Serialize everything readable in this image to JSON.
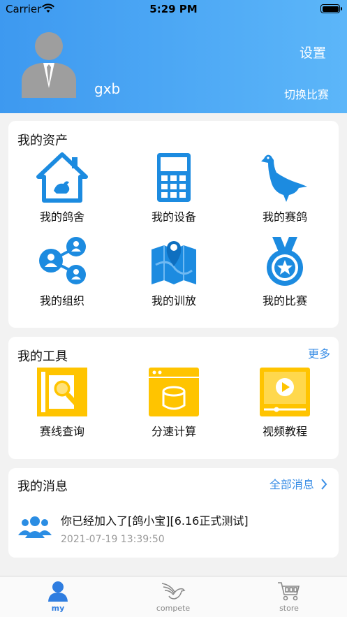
{
  "status_bar": {
    "carrier": "Carrier",
    "time": "5:29 PM"
  },
  "header": {
    "username": "gxb",
    "settings_label": "设置",
    "switch_label": "切换比赛"
  },
  "colors": {
    "header_start": "#3d99f0",
    "header_end": "#5cb6f9",
    "icon_blue": "#1c8be0",
    "icon_yellow": "#ffc400",
    "link_blue": "#3a8ee6",
    "tab_active": "#2f7de0"
  },
  "assets": {
    "title": "我的资产",
    "items": [
      {
        "label": "我的鸽舍",
        "icon": "house-pigeon-icon"
      },
      {
        "label": "我的设备",
        "icon": "device-icon"
      },
      {
        "label": "我的赛鸽",
        "icon": "pigeon-icon"
      },
      {
        "label": "我的组织",
        "icon": "organization-icon"
      },
      {
        "label": "我的训放",
        "icon": "map-pin-icon"
      },
      {
        "label": "我的比赛",
        "icon": "medal-icon"
      }
    ]
  },
  "tools": {
    "title": "我的工具",
    "more_label": "更多",
    "items": [
      {
        "label": "赛线查询",
        "icon": "search-book-icon"
      },
      {
        "label": "分速计算",
        "icon": "calculator-window-icon"
      },
      {
        "label": "视频教程",
        "icon": "video-icon"
      }
    ]
  },
  "messages": {
    "title": "我的消息",
    "all_label": "全部消息",
    "items": [
      {
        "text": "你已经加入了[鸽小宝][6.16正式测试]",
        "time": "2021-07-19 13:39:50",
        "icon": "group-icon"
      }
    ]
  },
  "tabbar": {
    "tabs": [
      {
        "label": "my",
        "icon": "person-icon",
        "active": true
      },
      {
        "label": "compete",
        "icon": "pigeon-wing-icon",
        "active": false
      },
      {
        "label": "store",
        "icon": "cart-icon",
        "active": false
      }
    ]
  }
}
